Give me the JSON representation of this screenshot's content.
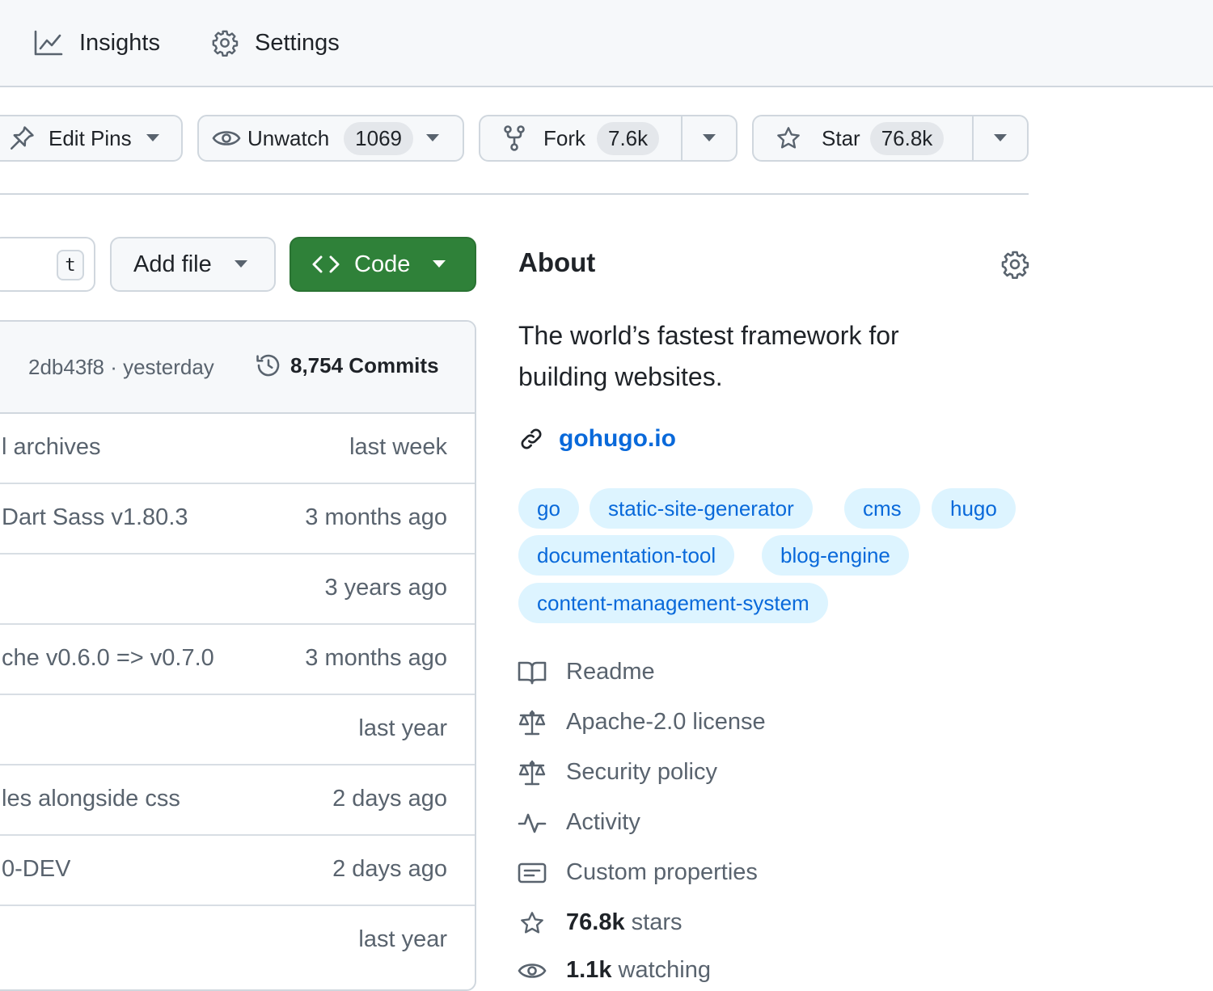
{
  "nav": {
    "insights": "Insights",
    "settings": "Settings"
  },
  "actions": {
    "edit_pins": "Edit Pins",
    "unwatch": "Unwatch",
    "watch_count": "1069",
    "fork": "Fork",
    "fork_count": "7.6k",
    "star": "Star",
    "star_count": "76.8k"
  },
  "toolbar": {
    "goto_shortcut": "t",
    "add_file": "Add file",
    "code": "Code"
  },
  "commit": {
    "sha_time": "2db43f8 · yesterday",
    "commits": "8,754 Commits"
  },
  "files": [
    {
      "message": "l archives",
      "time": "last week"
    },
    {
      "message": "Dart Sass v1.80.3",
      "time": "3 months ago"
    },
    {
      "message": "",
      "time": "3 years ago"
    },
    {
      "message": "che v0.6.0 => v0.7.0",
      "time": "3 months ago"
    },
    {
      "message": "",
      "time": "last year"
    },
    {
      "message": "les alongside css",
      "time": "2 days ago"
    },
    {
      "message": "0-DEV",
      "time": "2 days ago"
    },
    {
      "message": "",
      "time": "last year"
    }
  ],
  "about": {
    "title": "About",
    "description": "The world’s fastest framework for building websites.",
    "homepage": "gohugo.io",
    "topics": [
      "go",
      "static-site-generator",
      "cms",
      "hugo",
      "documentation-tool",
      "blog-engine",
      "content-management-system"
    ],
    "links": {
      "readme": "Readme",
      "license": "Apache-2.0 license",
      "security": "Security policy",
      "activity": "Activity",
      "custom_properties": "Custom properties",
      "stars_count": "76.8k",
      "stars_label": "stars",
      "watching_count": "1.1k",
      "watching_label": "watching"
    }
  },
  "colors": {
    "accent_link": "#0969da",
    "code_button": "#2f8139",
    "topic_bg": "#ddf4ff"
  }
}
